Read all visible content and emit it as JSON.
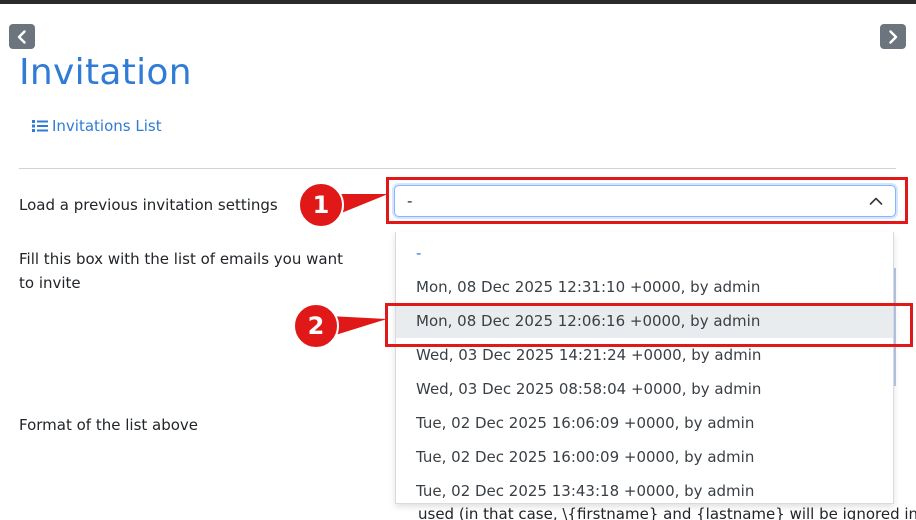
{
  "nav": {
    "prev_icon": "chevron-left-icon",
    "next_icon": "chevron-right-icon"
  },
  "page": {
    "title": "Invitation",
    "invitations_link": "Invitations List",
    "list_icon": "list-icon"
  },
  "form": {
    "load_label": "Load a previous invitation settings",
    "fill_label": "Fill this box with the list of emails you want to invite",
    "format_label": "Format of the list above",
    "select_value": "-",
    "caret_icon": "chevron-up-icon",
    "partial_text": "used (in that case, \\{firstname} and {lastname} will be ignored in"
  },
  "dropdown": {
    "options": [
      "-",
      "Mon, 08 Dec 2025 12:31:10 +0000, by admin",
      "Mon, 08 Dec 2025 12:06:16 +0000, by admin",
      "Wed, 03 Dec 2025 14:21:24 +0000, by admin",
      "Wed, 03 Dec 2025 08:58:04 +0000, by admin",
      "Tue, 02 Dec 2025 16:06:09 +0000, by admin",
      "Tue, 02 Dec 2025 16:00:09 +0000, by admin",
      "Tue, 02 Dec 2025 13:43:18 +0000, by admin"
    ],
    "selected_index": 0,
    "highlighted_index": 2
  },
  "annotations": {
    "marker_1": "1",
    "marker_2": "2",
    "color": "#e01818"
  },
  "colors": {
    "link": "#2f7bd6",
    "button": "#6c757d",
    "highlight": "#e9ecef"
  }
}
